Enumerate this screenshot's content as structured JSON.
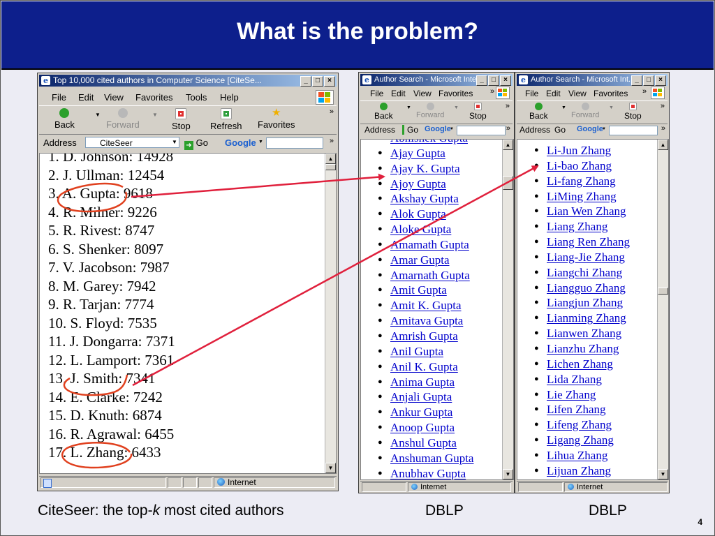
{
  "slide": {
    "title": "What is the problem?",
    "page_number": "4",
    "caption_citeseer_pre": "CiteSeer: the top-",
    "caption_citeseer_k": "k",
    "caption_citeseer_post": " most cited authors",
    "caption_dblp_1": "DBLP",
    "caption_dblp_2": "DBLP"
  },
  "colors": {
    "title_bar": "#0d1f8c",
    "link": "#0000cc",
    "annotation_circle": "#e0401e",
    "annotation_arrow": "#e0203c"
  },
  "citeseer_window": {
    "title": "Top 10,000 cited authors in Computer Science [CiteSe...",
    "menu": [
      "File",
      "Edit",
      "View",
      "Favorites",
      "Tools",
      "Help"
    ],
    "toolbar": {
      "back": "Back",
      "forward": "Forward",
      "stop": "Stop",
      "refresh": "Refresh",
      "favorites": "Favorites"
    },
    "address_label": "Address",
    "address_value": "CiteSeer",
    "go_label": "Go",
    "google_label": "Google",
    "status_text": "Internet",
    "ranking": [
      "1. D. Johnson: 14928",
      "2. J. Ullman: 12454",
      "3. A. Gupta: 9618",
      "4. R. Milner: 9226",
      "5. R. Rivest: 8747",
      "6. S. Shenker: 8097",
      "7. V. Jacobson: 7987",
      "8. M. Garey: 7942",
      "9. R. Tarjan: 7774",
      "10. S. Floyd: 7535",
      "11. J. Dongarra: 7371",
      "12. L. Lamport: 7361",
      "13. J. Smith: 7341",
      "14. E. Clarke: 7242",
      "15. D. Knuth: 6874",
      "16. R. Agrawal: 6455",
      "17. L. Zhang: 6433"
    ]
  },
  "dblp_gupta_window": {
    "title": "Author Search - Microsoft Inte...",
    "menu": [
      "File",
      "Edit",
      "View",
      "Favorites"
    ],
    "toolbar": {
      "back": "Back",
      "forward": "Forward",
      "stop": "Stop"
    },
    "address_label": "Address",
    "go_label": "Go",
    "google_label": "Google",
    "status_text": "Internet",
    "authors": [
      "Abhishek Gupta",
      "Ajay Gupta",
      "Ajay K. Gupta",
      "Ajoy Gupta",
      "Akshay Gupta",
      "Alok Gupta",
      "Aloke Gupta",
      "Amamath Gupta",
      "Amar Gupta",
      "Amarnath Gupta",
      "Amit Gupta",
      "Amit K. Gupta",
      "Amitava Gupta",
      "Amrish Gupta",
      "Anil Gupta",
      "Anil K. Gupta",
      "Anima Gupta",
      "Anjali Gupta",
      "Ankur Gupta",
      "Anoop Gupta",
      "Anshul Gupta",
      "Anshuman Gupta",
      "Anubhav Gupta"
    ]
  },
  "dblp_zhang_window": {
    "title": "Author Search - Microsoft Int...",
    "menu": [
      "File",
      "Edit",
      "View",
      "Favorites"
    ],
    "toolbar": {
      "back": "Back",
      "forward": "Forward",
      "stop": "Stop"
    },
    "address_label": "Address",
    "go_label": "Go",
    "google_label": "Google",
    "status_text": "Internet",
    "authors": [
      "Li-Jun Zhang",
      "Li-bao Zhang",
      "Li-fang Zhang",
      "LiMing Zhang",
      "Lian Wen Zhang",
      "Liang Zhang",
      "Liang Ren Zhang",
      "Liang-Jie Zhang",
      "Liangchi Zhang",
      "Liangguo Zhang",
      "Liangjun Zhang",
      "Lianming Zhang",
      "Lianwen Zhang",
      "Lianzhu Zhang",
      "Lichen Zhang",
      "Lida Zhang",
      "Lie Zhang",
      "Lifen Zhang",
      "Lifeng Zhang",
      "Ligang Zhang",
      "Lihua Zhang",
      "Lijuan Zhang"
    ]
  }
}
